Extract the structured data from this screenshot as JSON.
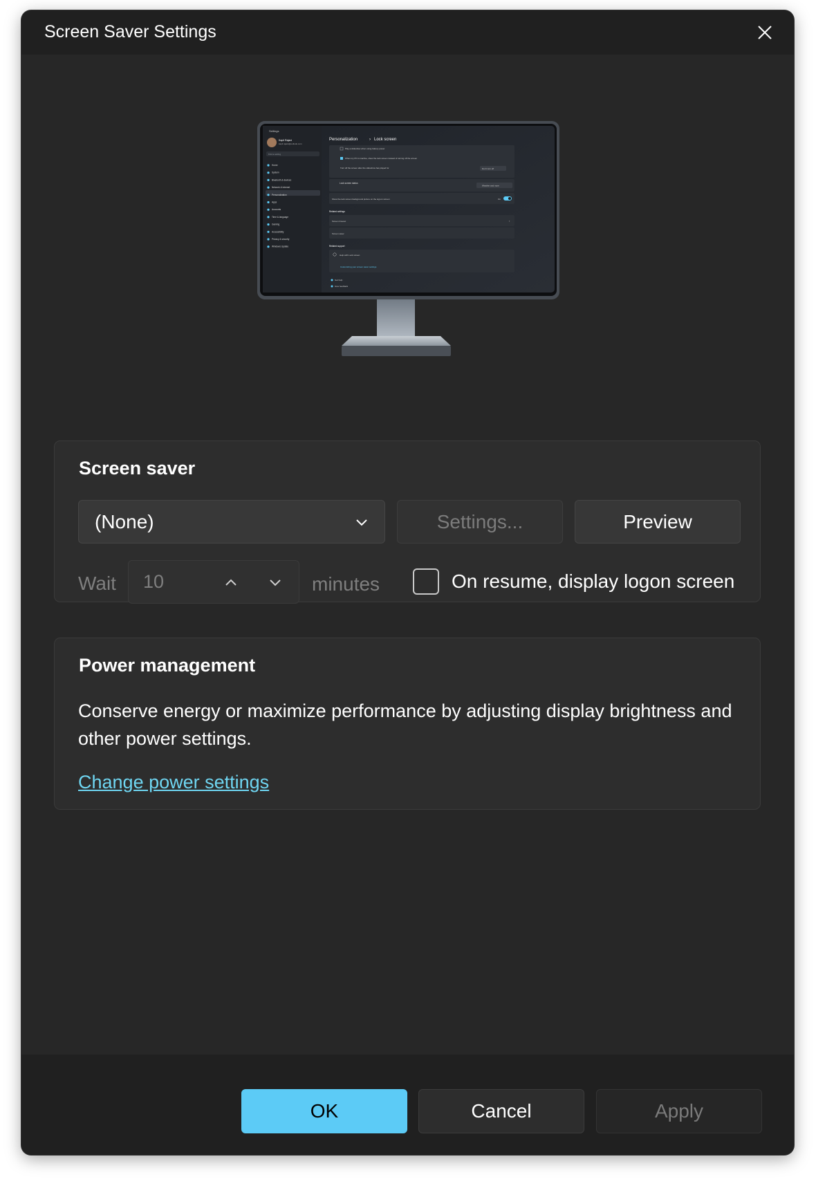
{
  "window": {
    "title": "Screen Saver Settings"
  },
  "preview_screen": {
    "settings_title": "Settings",
    "user_name": "Kapil Rajani",
    "user_email": "kapil.rajani@outlook.com",
    "search_placeholder": "Find a setting",
    "nav": [
      "Home",
      "System",
      "Bluetooth & devices",
      "Network & internet",
      "Personalization",
      "Apps",
      "Accounts",
      "Time & language",
      "Gaming",
      "Accessibility",
      "Privacy & security",
      "Windows Update"
    ],
    "breadcrumb_parent": "Personalization",
    "breadcrumb_current": "Lock screen",
    "rows": [
      "Play a slideshow when using battery power",
      "When my PC is inactive, show the lock screen instead of turning off the screen",
      "Turn off the screen after the slideshow has played for",
      "Lock screen status",
      "Show the lock screen background picture on the sign-in screen"
    ],
    "turn_off_value": "Don't turn off",
    "status_value": "Weather and more",
    "toggle_label": "On",
    "related_settings": "Related settings",
    "screen_timeout": "Screen timeout",
    "screen_saver": "Screen saver",
    "related_support": "Related support",
    "help_lock": "Help with Lock screen",
    "customizing": "Customizing your screen saver settings",
    "get_help": "Get help",
    "give_feedback": "Give feedback"
  },
  "screen_saver": {
    "heading": "Screen saver",
    "selected": "(None)",
    "settings_button": "Settings...",
    "preview_button": "Preview",
    "wait_label": "Wait",
    "wait_value": "10",
    "minutes_label": "minutes",
    "logon_checkbox_label": "On resume, display logon screen",
    "logon_checked": false
  },
  "power_management": {
    "heading": "Power management",
    "description": "Conserve energy or maximize performance by adjusting display brightness and other power settings.",
    "link": "Change power settings"
  },
  "footer": {
    "ok": "OK",
    "cancel": "Cancel",
    "apply": "Apply"
  },
  "colors": {
    "accent": "#5ccbf6",
    "link": "#6fd6f2",
    "background": "#202020",
    "card": "#2d2d2d"
  }
}
